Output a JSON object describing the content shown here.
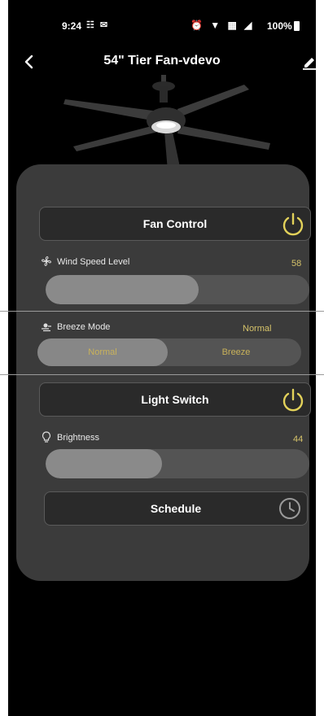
{
  "status_bar": {
    "time": "9:24",
    "left_icons": "☷ ✉",
    "right_icons": "⏰ ▼ ▦ ◢",
    "battery": "100%"
  },
  "header": {
    "title": "54\" Tier Fan-vdevo"
  },
  "fan_control": {
    "label": "Fan Control"
  },
  "wind_speed": {
    "label": "Wind Speed Level",
    "value": "58",
    "level_percent": 58
  },
  "breeze_mode": {
    "label": "Breeze Mode",
    "value": "Normal",
    "options": [
      "Normal",
      "Breeze"
    ],
    "selected": "Normal"
  },
  "light_switch": {
    "label": "Light Switch"
  },
  "brightness": {
    "label": "Brightness",
    "value": "44",
    "level_percent": 44
  },
  "schedule": {
    "label": "Schedule"
  },
  "colors": {
    "accent": "#e3d25a",
    "card": "#3b3b3b",
    "value_text": "#d6c36a"
  }
}
